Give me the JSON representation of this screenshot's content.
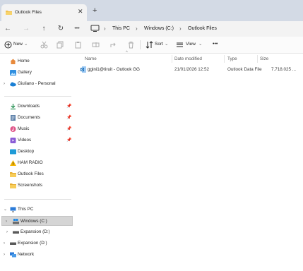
{
  "window": {
    "tab_title": "Outlook Files",
    "close_glyph": "✕",
    "add_glyph": "+"
  },
  "nav": {
    "back": "←",
    "forward": "→",
    "up": "↑",
    "refresh": "↻",
    "more": "•••",
    "breadcrumb_sep": "›",
    "breadcrumbs": [
      "This PC",
      "Windows (C:)",
      "Outlook Files"
    ]
  },
  "toolbar": {
    "new_label": "New",
    "sort_label": "Sort",
    "view_label": "View",
    "more_label": "•••",
    "dropdown_glyph": "⌄",
    "icons": [
      "plus-circle-icon",
      "cut-icon",
      "copy-icon",
      "paste-icon",
      "rename-icon",
      "share-icon",
      "delete-icon",
      "sort-icon",
      "view-icon"
    ]
  },
  "sidebar": {
    "quick": [
      {
        "label": "Home",
        "icon": "home-icon"
      },
      {
        "label": "Gallery",
        "icon": "gallery-icon"
      },
      {
        "label": "Giuliano - Personal",
        "icon": "onedrive-cloud-icon",
        "expand": "›"
      }
    ],
    "pinned": [
      {
        "label": "Downloads",
        "icon": "downloads-icon",
        "pin": "📌"
      },
      {
        "label": "Documents",
        "icon": "documents-icon",
        "pin": "📌"
      },
      {
        "label": "Music",
        "icon": "music-icon",
        "pin": "📌"
      },
      {
        "label": "Videos",
        "icon": "videos-icon",
        "pin": "📌"
      },
      {
        "label": "Desktop",
        "icon": "desktop-icon"
      },
      {
        "label": "HAM RADIO",
        "icon": "warning-folder-icon"
      },
      {
        "label": "Outlook Files",
        "icon": "folder-icon"
      },
      {
        "label": "Screenshots",
        "icon": "folder-icon"
      }
    ],
    "drives": [
      {
        "label": "This PC",
        "icon": "pc-icon",
        "expand": "⌄"
      },
      {
        "label": "Windows (C:)",
        "icon": "windows-drive-icon",
        "expand": "›",
        "selected": true
      },
      {
        "label": "Expansion (D:)",
        "icon": "drive-icon",
        "expand": "›"
      },
      {
        "label": "Expansion (D:)",
        "icon": "drive-icon",
        "expand": "›"
      },
      {
        "label": "Network",
        "icon": "network-icon",
        "expand": "›"
      }
    ]
  },
  "content": {
    "sort_caret": "^",
    "columns": [
      "Name",
      "Date modified",
      "Type",
      "Size"
    ],
    "files": [
      {
        "name": "ggini1@tiruit - Outlook GG",
        "date": "21/01/2026 12:52",
        "type": "Outlook Data File",
        "size": "7.718.025 ..."
      }
    ]
  },
  "colors": {
    "tabstrip": "#d3dae5",
    "accent_blue": "#1f6fd0",
    "folder_yellow": "#f2c14e",
    "selected_row": "#d5d5d5"
  }
}
